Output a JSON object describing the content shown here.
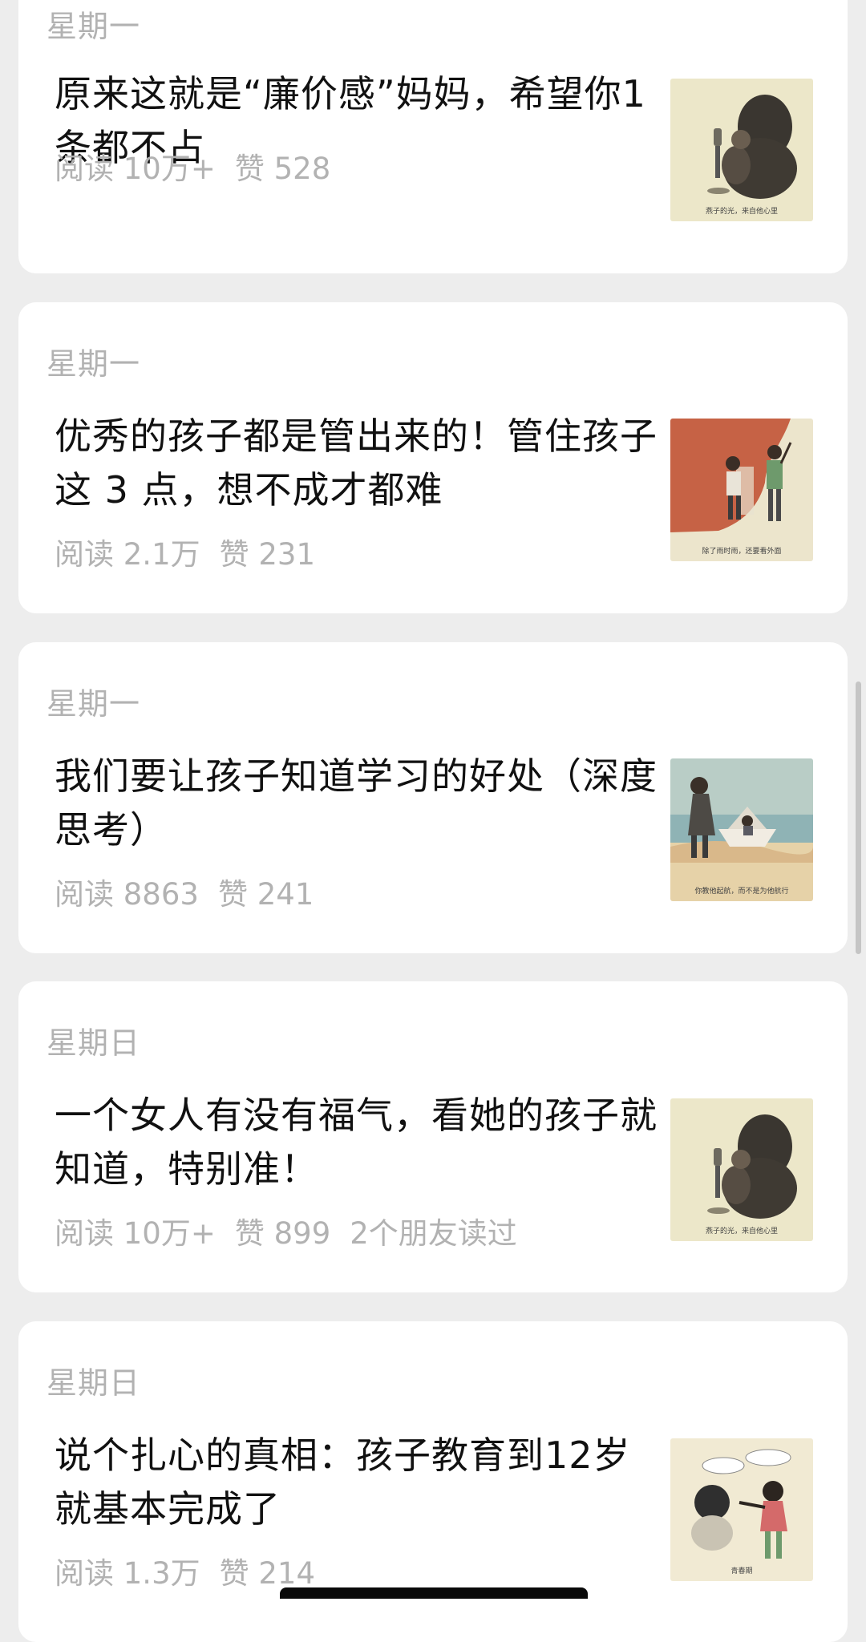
{
  "articles": [
    {
      "weekday": "星期一",
      "title": "原来这就是“廉价感”妈妈，希望你1条都不占",
      "read": "阅读 10万+",
      "likes": "赞 528",
      "friends": "",
      "thumb_caption": "燕子的光，来自他心里",
      "thumb_icon": "mother-child-illustration-icon"
    },
    {
      "weekday": "星期一",
      "title": "优秀的孩子都是管出来的！管住孩子这 3 点，想不成才都难",
      "read": "阅读 2.1万",
      "likes": "赞 231",
      "friends": "",
      "thumb_caption": "除了雨时雨，还要看外面",
      "thumb_icon": "painting-wall-illustration-icon"
    },
    {
      "weekday": "星期一",
      "title": "我们要让孩子知道学习的好处（深度思考）",
      "read": "阅读 8863",
      "likes": "赞 241",
      "friends": "",
      "thumb_caption": "你教他起航，而不是为他航行",
      "thumb_icon": "paper-boat-illustration-icon"
    },
    {
      "weekday": "星期日",
      "title": "一个女人有没有福气，看她的孩子就知道，特别准！",
      "read": "阅读 10万+",
      "likes": "赞 899",
      "friends": "2个朋友读过",
      "thumb_caption": "燕子的光，来自他心里",
      "thumb_icon": "mother-child-illustration-icon"
    },
    {
      "weekday": "星期日",
      "title": "说个扎心的真相：孩子教育到12岁就基本完成了",
      "read": "阅读 1.3万",
      "likes": "赞 214",
      "friends": "",
      "thumb_caption": "青春期",
      "thumb_icon": "quarrel-illustration-icon"
    }
  ],
  "colors": {
    "background": "#ededed",
    "card": "#ffffff",
    "title_text": "#111111",
    "meta_text": "#b2b2b2"
  }
}
